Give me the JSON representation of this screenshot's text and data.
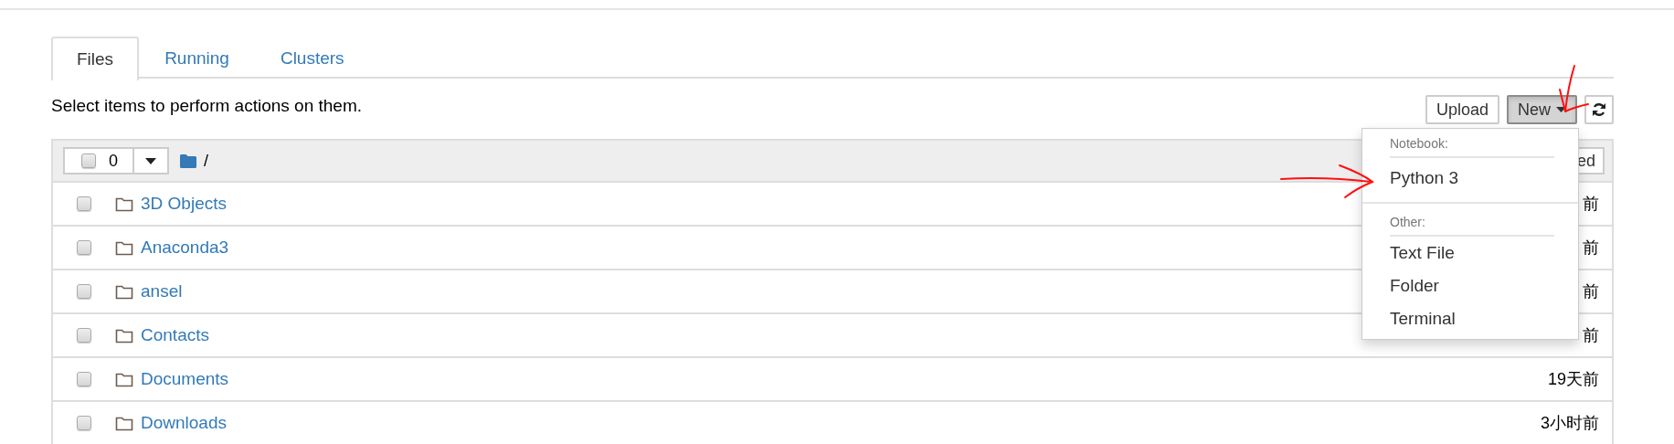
{
  "tabs": [
    {
      "label": "Files",
      "selected": true
    },
    {
      "label": "Running",
      "selected": false
    },
    {
      "label": "Clusters",
      "selected": false
    }
  ],
  "instruction": "Select items to perform actions on them.",
  "toolbar": [
    {
      "kind": "upload",
      "label": "Upload",
      "active": false
    },
    {
      "kind": "new",
      "label": "New",
      "active": true
    },
    {
      "kind": "refresh",
      "active": false
    }
  ],
  "list_header": {
    "checked": false,
    "selected_count": "0",
    "path": "/",
    "sort_button": "ed"
  },
  "rows": [
    {
      "name": "3D Objects",
      "modified": "前",
      "checked": false
    },
    {
      "name": "Anaconda3",
      "modified": "前",
      "checked": false
    },
    {
      "name": "ansel",
      "modified": "前",
      "checked": false
    },
    {
      "name": "Contacts",
      "modified": "前",
      "checked": false
    },
    {
      "name": "Documents",
      "modified": "19天前",
      "checked": false
    },
    {
      "name": "Downloads",
      "modified": "3小时前",
      "checked": false
    }
  ],
  "new_menu": {
    "sections": [
      {
        "heading": "Notebook:",
        "items": [
          "Python 3"
        ]
      },
      {
        "heading": "Other:",
        "items": [
          "Text File",
          "Folder",
          "Terminal"
        ]
      }
    ]
  }
}
